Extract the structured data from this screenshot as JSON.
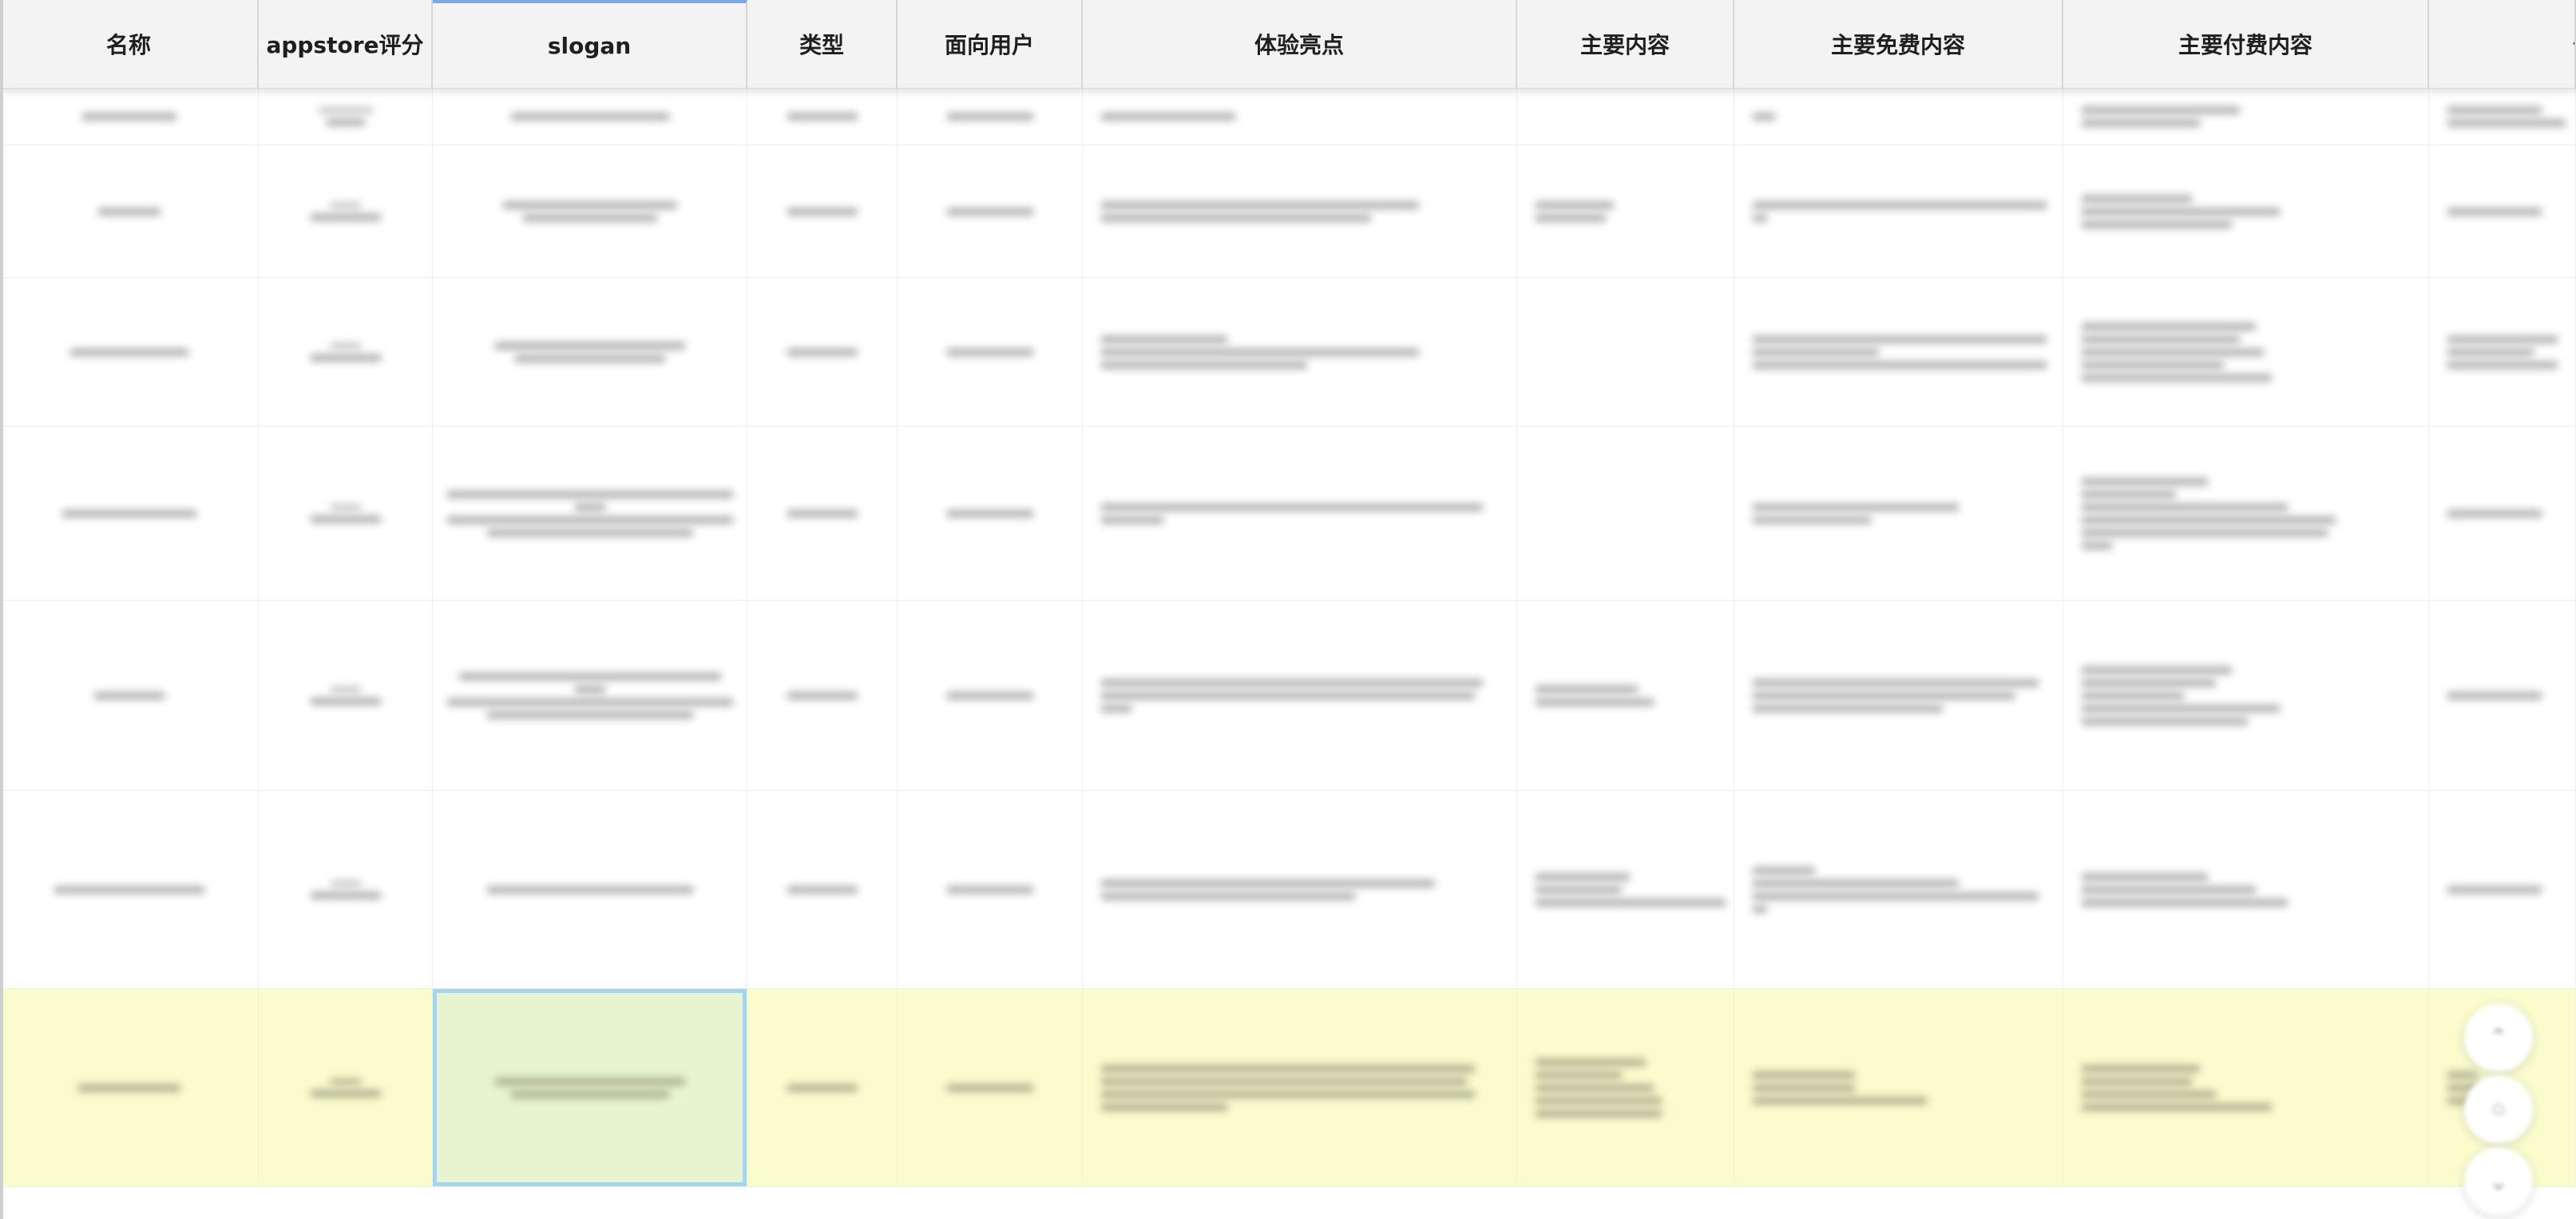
{
  "table": {
    "columns": [
      {
        "label": "名称"
      },
      {
        "label": "appstore评分"
      },
      {
        "label": "slogan"
      },
      {
        "label": "类型"
      },
      {
        "label": "面向用户"
      },
      {
        "label": "体验亮点"
      },
      {
        "label": "主要内容"
      },
      {
        "label": "主要免费内容"
      },
      {
        "label": "主要付费内容"
      },
      {
        "label": "付"
      }
    ],
    "selected_column": "slogan",
    "highlight_color": "#fafccd",
    "active_cell_color": "#e8f4cf",
    "content_obscured": true
  },
  "fab_icons": [
    "chevron-up-icon",
    "circle-icon",
    "chevron-down-icon"
  ]
}
